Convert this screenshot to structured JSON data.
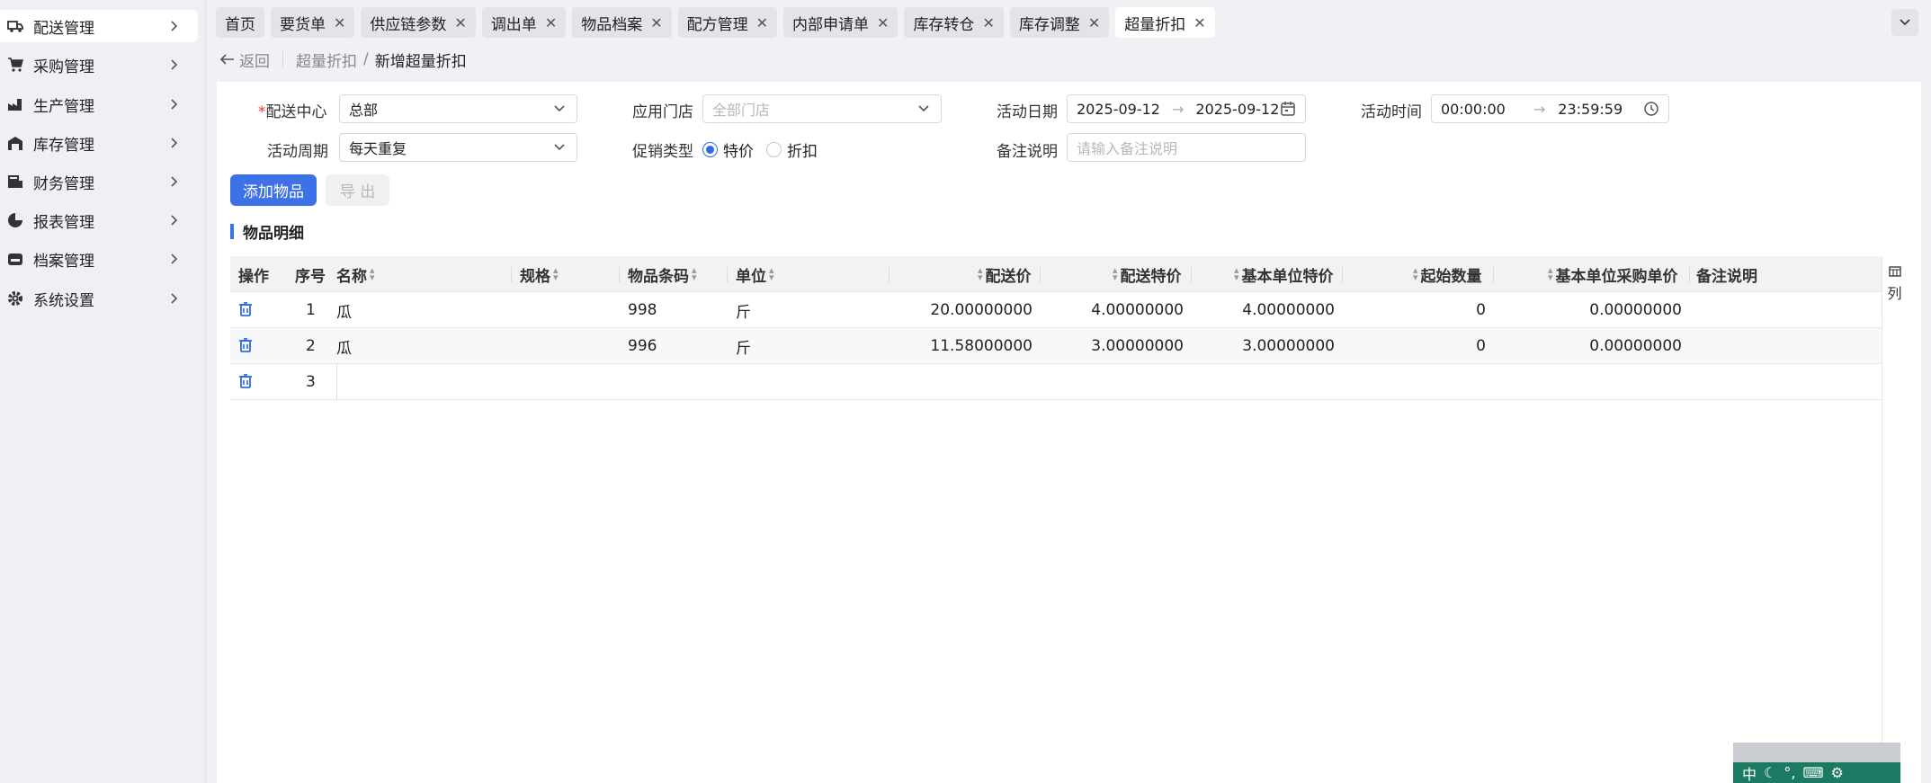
{
  "sidebar": {
    "items": [
      {
        "label": "配送管理",
        "icon": "truck-icon"
      },
      {
        "label": "采购管理",
        "icon": "cart-icon"
      },
      {
        "label": "生产管理",
        "icon": "factory-icon"
      },
      {
        "label": "库存管理",
        "icon": "warehouse-icon"
      },
      {
        "label": "财务管理",
        "icon": "finance-icon"
      },
      {
        "label": "报表管理",
        "icon": "report-icon"
      },
      {
        "label": "档案管理",
        "icon": "archive-icon"
      },
      {
        "label": "系统设置",
        "icon": "gear-icon"
      }
    ]
  },
  "tabs": [
    {
      "label": "首页"
    },
    {
      "label": "要货单"
    },
    {
      "label": "供应链参数"
    },
    {
      "label": "调出单"
    },
    {
      "label": "物品档案"
    },
    {
      "label": "配方管理"
    },
    {
      "label": "内部申请单"
    },
    {
      "label": "库存转仓"
    },
    {
      "label": "库存调整"
    },
    {
      "label": "超量折扣"
    }
  ],
  "breadcrumb": {
    "back": "返回",
    "parent": "超量折扣",
    "separator": "/",
    "current": "新增超量折扣"
  },
  "form": {
    "center_label": "配送中心",
    "center_required": "*",
    "center_value": "总部",
    "store_label": "应用门店",
    "store_placeholder": "全部门店",
    "date_label": "活动日期",
    "date_start": "2025-09-12",
    "date_end": "2025-09-12",
    "time_label": "活动时间",
    "time_start": "00:00:00",
    "time_end": "23:59:59",
    "range_arrow": "→",
    "cycle_label": "活动周期",
    "cycle_value": "每天重复",
    "promo_label": "促销类型",
    "promo_opt1": "特价",
    "promo_opt2": "折扣",
    "remark_label": "备注说明",
    "remark_placeholder": "请输入备注说明"
  },
  "actions": {
    "add": "添加物品",
    "export": "导 出"
  },
  "section_title": "物品明细",
  "table": {
    "headers": {
      "op": "操作",
      "seq": "序号",
      "name": "名称",
      "spec": "规格",
      "barcode": "物品条码",
      "unit": "单位",
      "price": "配送价",
      "special": "配送特价",
      "base_special": "基本单位特价",
      "start_qty": "起始数量",
      "base_purchase": "基本单位采购单价",
      "remark": "备注说明"
    },
    "rows": [
      {
        "seq": "1",
        "name": "瓜",
        "spec": "",
        "barcode": "998",
        "unit": "斤",
        "price": "20.00000000",
        "special": "4.00000000",
        "base_special": "4.00000000",
        "start_qty": "0",
        "base_purchase": "0.00000000",
        "remark": ""
      },
      {
        "seq": "2",
        "name": "瓜",
        "spec": "",
        "barcode": "996",
        "unit": "斤",
        "price": "11.58000000",
        "special": "3.00000000",
        "base_special": "3.00000000",
        "start_qty": "0",
        "base_purchase": "0.00000000",
        "remark": ""
      },
      {
        "seq": "3",
        "name": "",
        "spec": "",
        "barcode": "",
        "unit": "",
        "price": "",
        "special": "",
        "base_special": "",
        "start_qty": "",
        "base_purchase": "",
        "remark": ""
      }
    ],
    "column_toggle": "列"
  },
  "ime": {
    "label": "中"
  },
  "colors": {
    "primary": "#3d72e6",
    "required": "#ee3333",
    "ime_bar": "#1b7a62"
  }
}
